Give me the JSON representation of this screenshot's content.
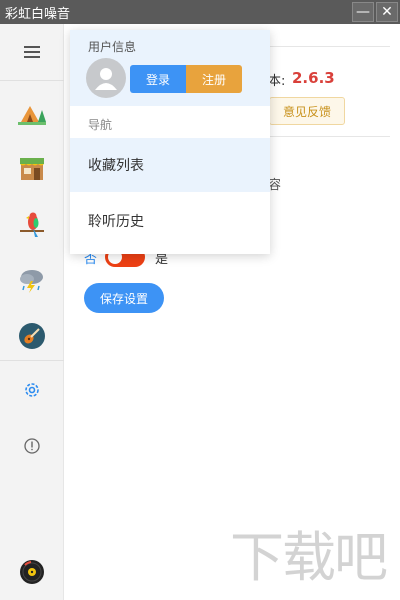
{
  "window": {
    "title": "彩虹白噪音",
    "minimize_icon": "—",
    "close_icon": "✕"
  },
  "sidebar": {
    "items": [
      {
        "name": "menu-icon"
      },
      {
        "name": "camping-icon"
      },
      {
        "name": "shop-icon"
      },
      {
        "name": "parrot-icon"
      },
      {
        "name": "thunderstorm-icon"
      },
      {
        "name": "guitar-icon"
      },
      {
        "name": "settings-icon"
      },
      {
        "name": "info-icon"
      },
      {
        "name": "vinyl-record-icon"
      }
    ],
    "accent": "#2d8cf0"
  },
  "main": {
    "version_label": "本:",
    "version_number": "2.6.3",
    "feedback_button": "意见反馈",
    "content_text": "容",
    "toggle_left_label": "否",
    "toggle_right_label": "是",
    "save_button": "保存设置"
  },
  "dropdown": {
    "user_info_label": "用户信息",
    "login_button": "登录",
    "register_button": "注册",
    "nav_label": "导航",
    "items": [
      {
        "label": "收藏列表",
        "active": true
      },
      {
        "label": "聆听历史",
        "active": false
      }
    ]
  },
  "watermark": {
    "text": "下载吧"
  }
}
